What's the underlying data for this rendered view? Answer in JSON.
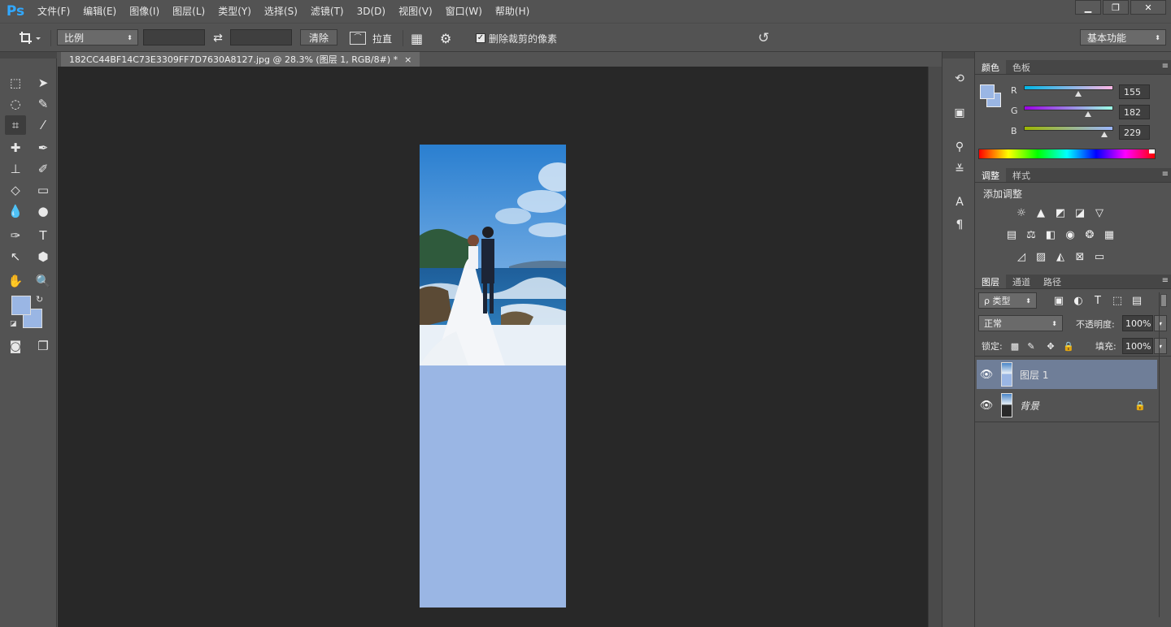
{
  "app": {
    "logo": "Ps"
  },
  "menu": [
    "文件(F)",
    "编辑(E)",
    "图像(I)",
    "图层(L)",
    "类型(Y)",
    "选择(S)",
    "滤镜(T)",
    "3D(D)",
    "视图(V)",
    "窗口(W)",
    "帮助(H)"
  ],
  "window_controls": {
    "minimize": "▁",
    "restore": "❐",
    "close": "✕"
  },
  "options": {
    "ratio_select": "比例",
    "ratio_width": "",
    "ratio_height": "",
    "swap_icon": "swap-arrows-icon",
    "clear_button": "清除",
    "straighten_label": "拉直",
    "delete_cropped_checked": true,
    "delete_cropped_label": "删除裁剪的像素",
    "workspace": "基本功能"
  },
  "document": {
    "tab_title": "182CC44BF14C73E3309FF7D7630A8127.jpg @ 28.3% (图层 1, RGB/8#) *",
    "close_glyph": "×"
  },
  "colors": {
    "foreground": "#9ab6e4",
    "background": "#9ab6e4",
    "accent_selected_layer": "#6f7e98"
  },
  "color_panel": {
    "tabs": [
      "颜色",
      "色板"
    ],
    "r_label": "R",
    "g_label": "G",
    "b_label": "B",
    "r": 155,
    "g": 182,
    "b": 229
  },
  "adjust_panel": {
    "tabs": [
      "调整",
      "样式"
    ],
    "title": "添加调整"
  },
  "layers_panel": {
    "tabs": [
      "图层",
      "通道",
      "路径"
    ],
    "filter_label": "ρ 类型",
    "blend_mode": "正常",
    "opacity_label": "不透明度:",
    "opacity_value": "100%",
    "lock_label": "锁定:",
    "fill_label": "填充:",
    "fill_value": "100%",
    "layers": [
      {
        "name": "图层 1",
        "selected": true,
        "locked": false
      },
      {
        "name": "背景",
        "selected": false,
        "locked": true
      }
    ]
  }
}
